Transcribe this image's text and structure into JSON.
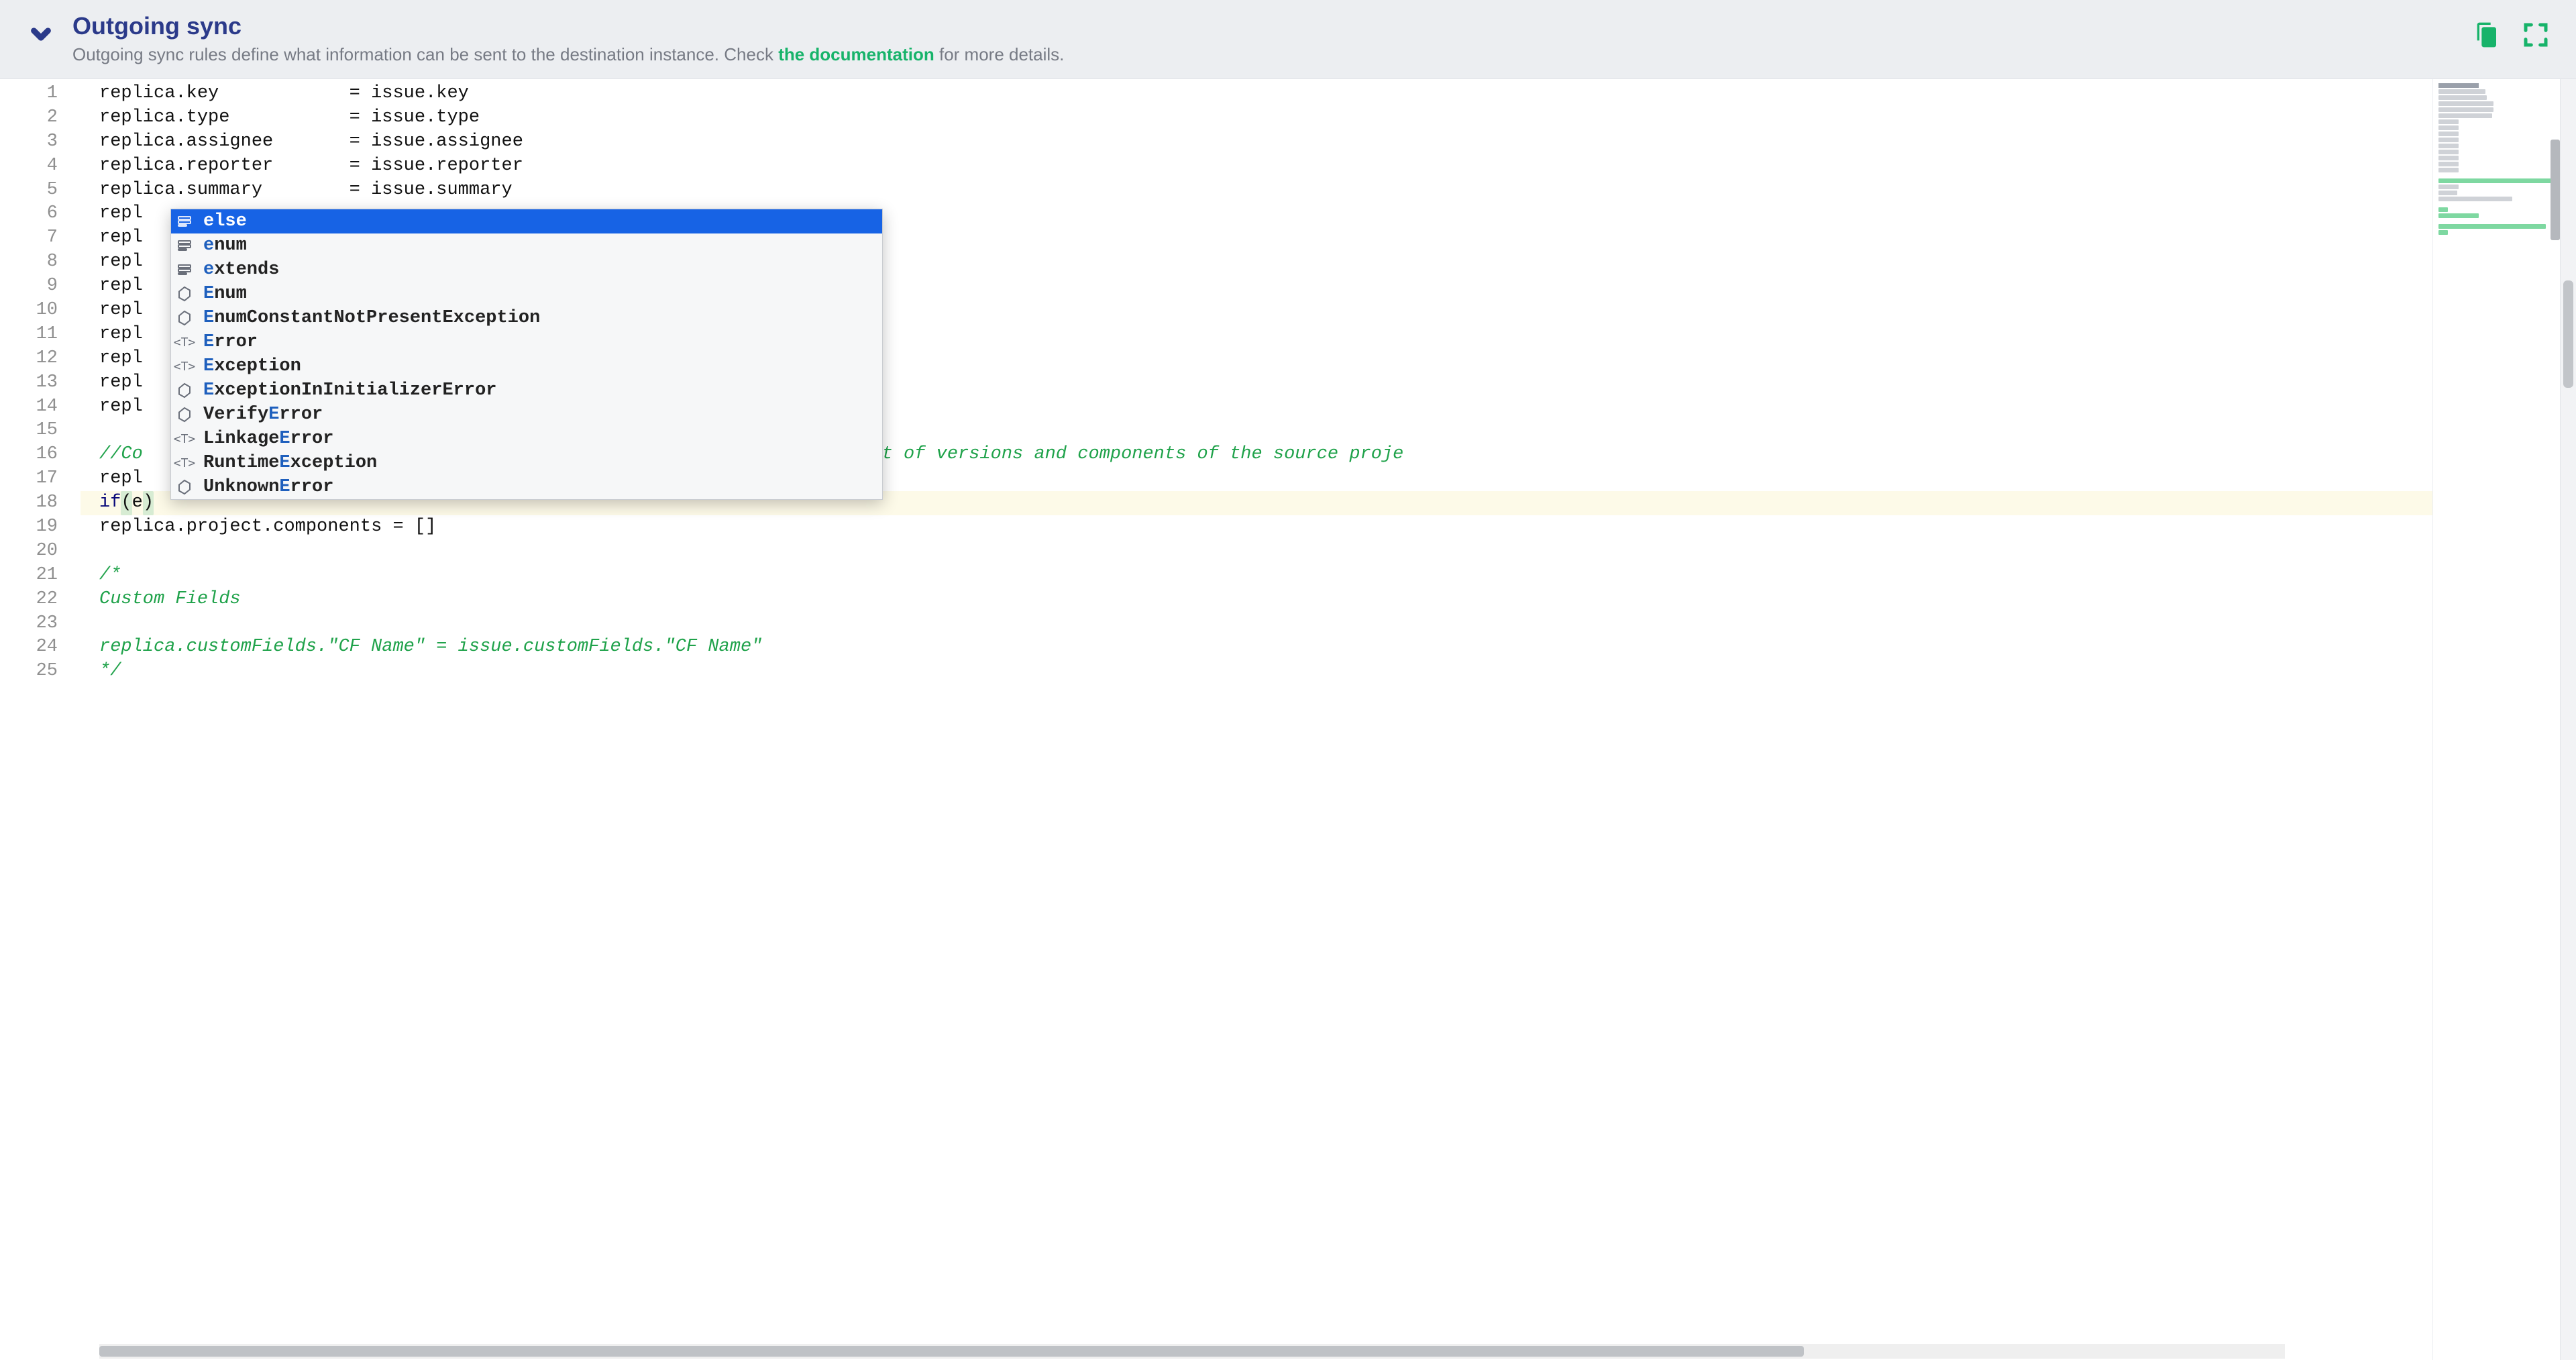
{
  "header": {
    "title": "Outgoing sync",
    "desc_prefix": "Outgoing sync rules define what information can be sent to the destination instance. Check ",
    "doc_link": "the documentation",
    "desc_suffix": " for more details."
  },
  "editor": {
    "language": "groovy",
    "lines": [
      {
        "n": 1,
        "segments": [
          {
            "t": "replica.key            = issue.key",
            "c": "plain"
          }
        ]
      },
      {
        "n": 2,
        "segments": [
          {
            "t": "replica.type           = issue.type",
            "c": "plain"
          }
        ]
      },
      {
        "n": 3,
        "segments": [
          {
            "t": "replica.assignee       = issue.assignee",
            "c": "plain"
          }
        ]
      },
      {
        "n": 4,
        "segments": [
          {
            "t": "replica.reporter       = issue.reporter",
            "c": "plain"
          }
        ]
      },
      {
        "n": 5,
        "segments": [
          {
            "t": "replica.summary        = issue.summary",
            "c": "plain"
          }
        ]
      },
      {
        "n": 6,
        "segments": [
          {
            "t": "repl",
            "c": "plain"
          }
        ]
      },
      {
        "n": 7,
        "segments": [
          {
            "t": "repl",
            "c": "plain"
          }
        ]
      },
      {
        "n": 8,
        "segments": [
          {
            "t": "repl",
            "c": "plain"
          }
        ]
      },
      {
        "n": 9,
        "segments": [
          {
            "t": "repl",
            "c": "plain"
          }
        ]
      },
      {
        "n": 10,
        "segments": [
          {
            "t": "repl",
            "c": "plain"
          }
        ]
      },
      {
        "n": 11,
        "segments": [
          {
            "t": "repl",
            "c": "plain"
          }
        ]
      },
      {
        "n": 12,
        "segments": [
          {
            "t": "repl",
            "c": "plain"
          }
        ]
      },
      {
        "n": 13,
        "segments": [
          {
            "t": "repl",
            "c": "plain"
          }
        ]
      },
      {
        "n": 14,
        "segments": [
          {
            "t": "repl",
            "c": "plain"
          }
        ]
      },
      {
        "n": 15,
        "segments": []
      },
      {
        "n": 16,
        "segments": [
          {
            "t": "//Co",
            "c": "comment"
          },
          {
            "t": "                                                            ",
            "c": "plain"
          },
          {
            "t": "full list of versions and components of the source proje",
            "c": "comment"
          }
        ]
      },
      {
        "n": 17,
        "segments": [
          {
            "t": "repl",
            "c": "plain"
          }
        ]
      },
      {
        "n": 18,
        "current": true,
        "segments": [
          {
            "t": "if",
            "c": "keyword"
          },
          {
            "t": "(",
            "c": "paren-hl"
          },
          {
            "t": "e",
            "c": "plain"
          },
          {
            "t": ")",
            "c": "paren-hl"
          }
        ]
      },
      {
        "n": 19,
        "segments": [
          {
            "t": "replica.project.components = []",
            "c": "plain"
          }
        ]
      },
      {
        "n": 20,
        "segments": []
      },
      {
        "n": 21,
        "segments": [
          {
            "t": "/*",
            "c": "comment"
          }
        ]
      },
      {
        "n": 22,
        "segments": [
          {
            "t": "Custom Fields",
            "c": "comment"
          }
        ]
      },
      {
        "n": 23,
        "segments": []
      },
      {
        "n": 24,
        "segments": [
          {
            "t": "replica.customFields.\"CF Name\" = issue.customFields.\"CF Name\"",
            "c": "comment"
          }
        ]
      },
      {
        "n": 25,
        "segments": [
          {
            "t": "*/",
            "c": "comment"
          }
        ]
      }
    ],
    "caret_line": 18
  },
  "suggest": {
    "selected_index": 0,
    "items": [
      {
        "icon": "block",
        "text": "else",
        "match_end": 1
      },
      {
        "icon": "block",
        "text": "enum",
        "match_end": 1
      },
      {
        "icon": "block",
        "text": "extends",
        "match_end": 1
      },
      {
        "icon": "hex",
        "text": "Enum",
        "match_start": 0,
        "match_end": 1
      },
      {
        "icon": "hex",
        "text": "EnumConstantNotPresentException",
        "match_start": 0,
        "match_end": 1
      },
      {
        "icon": "t",
        "text": "Error",
        "match_start": 0,
        "match_end": 1
      },
      {
        "icon": "t",
        "text": "Exception",
        "match_start": 0,
        "match_end": 1
      },
      {
        "icon": "hex",
        "text": "ExceptionInInitializerError",
        "match_start": 0,
        "match_end": 1
      },
      {
        "icon": "hex",
        "text": "VerifyError",
        "match_start": 6,
        "match_end": 7
      },
      {
        "icon": "t",
        "text": "LinkageError",
        "match_start": 7,
        "match_end": 8
      },
      {
        "icon": "t",
        "text": "RuntimeException",
        "match_start": 7,
        "match_end": 8
      },
      {
        "icon": "hex",
        "text": "UnknownError",
        "match_start": 7,
        "match_end": 8
      }
    ]
  },
  "colors": {
    "brand_blue": "#2b3a8a",
    "accent_green": "#17b36a",
    "selection_blue": "#1763e5"
  }
}
